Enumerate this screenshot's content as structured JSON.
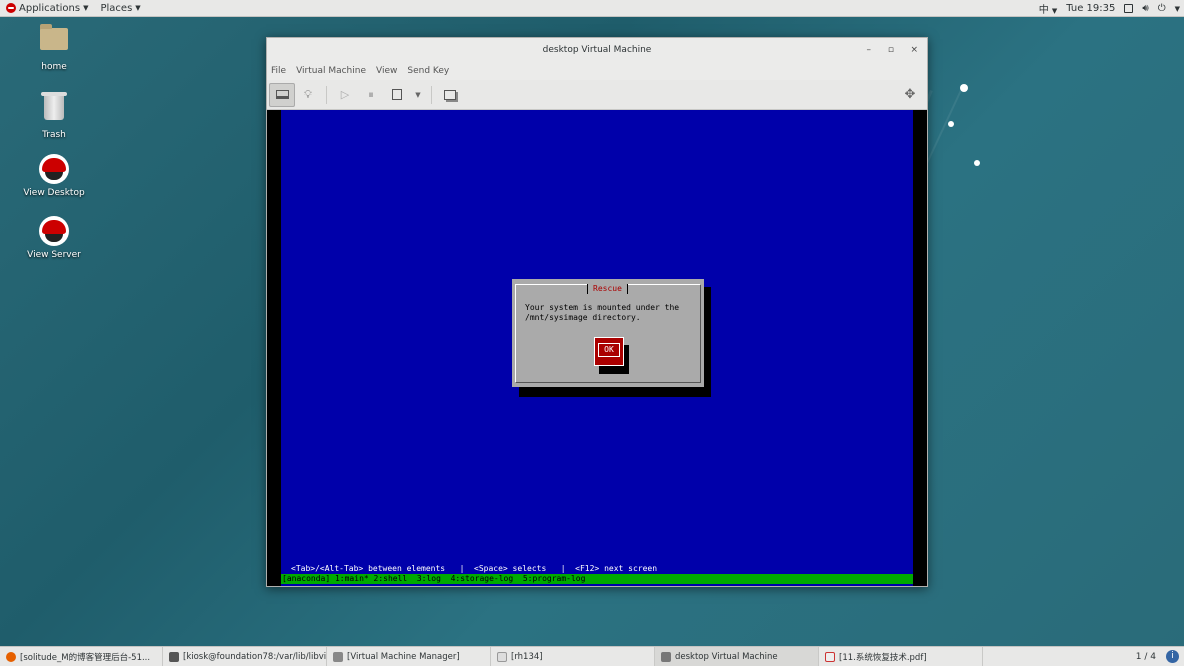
{
  "top_panel": {
    "applications": "Applications",
    "places": "Places",
    "input_method": "中",
    "clock": "Tue 19:35"
  },
  "desktop_icons": {
    "home": "home",
    "trash": "Trash",
    "view_desktop": "View Desktop",
    "view_server": "View Server"
  },
  "vm_window": {
    "title": "desktop Virtual Machine",
    "minimize": "–",
    "maximize": "▫",
    "close": "×",
    "menu": [
      "File",
      "Virtual Machine",
      "View",
      "Send Key"
    ]
  },
  "console": {
    "dialog_title": "Rescue",
    "dialog_text": "Your system is mounted under the\n/mnt/sysimage directory.",
    "ok_label": "OK",
    "help_line": "<Tab>/<Alt-Tab> between elements   |  <Space> selects   |  <F12> next screen",
    "status_line": "[anaconda] 1:main* 2:shell  3:log  4:storage-log  5:program-log"
  },
  "taskbar": {
    "items": [
      "[solitude_M的博客管理后台-51...",
      "[kiosk@foundation78:/var/lib/libvi...",
      "[Virtual Machine Manager]",
      "[rh134]",
      "desktop Virtual Machine",
      "[11.系统恢复技术.pdf]"
    ],
    "workspace": "1 / 4"
  },
  "colors": {
    "console_bg": "#0000aa",
    "dialog_bg": "#aaaaaa",
    "ok_bg": "#aa0000",
    "status_bar": "#00aa00"
  }
}
